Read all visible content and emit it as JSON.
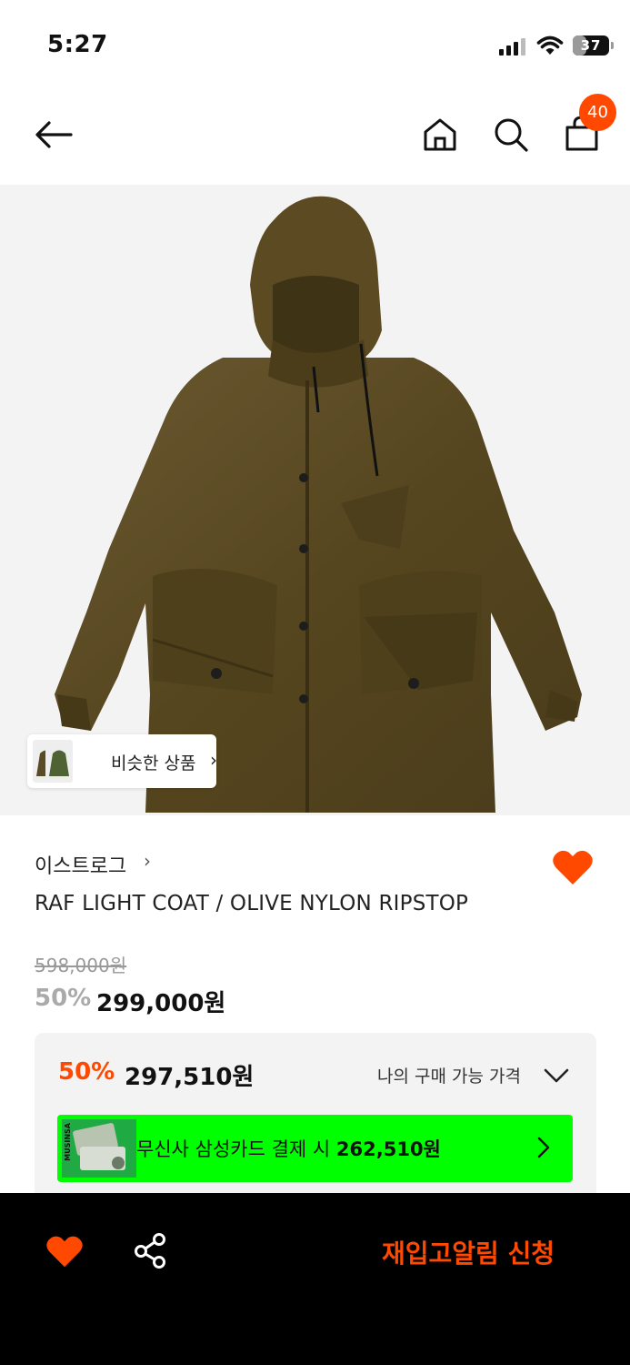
{
  "status_bar": {
    "time": "5:27",
    "battery_text": "37",
    "battery_level": 0.37,
    "icons": [
      "cellular-signal-icon",
      "wifi-icon",
      "battery-icon"
    ]
  },
  "nav": {
    "icons": [
      "back-arrow-icon",
      "home-icon",
      "search-icon",
      "shopping-bag-icon"
    ],
    "cart_count": "40"
  },
  "product_image": {
    "subject": "olive-parka-photo"
  },
  "similar": {
    "label": "비슷한 상품",
    "arrow": "›"
  },
  "product": {
    "brand": "이스트로그",
    "brand_arrow": "›",
    "name": "RAF LIGHT COAT / OLIVE NYLON RIPSTOP",
    "original_price": "598,000원",
    "discount_rate": "50%",
    "sale_price": "299,000원",
    "liked": true
  },
  "benefit": {
    "rate": "50%",
    "price": "297,510원",
    "toggle_label": "나의 구매 가능 가격"
  },
  "card_banner": {
    "thumb_text": "MUSINSA",
    "text": "무신사 삼성카드 결제 시 ",
    "amount": "262,510원"
  },
  "bottom_bar": {
    "restock_label": "재입고알림 신청"
  },
  "colors": {
    "accent": "#ff4800",
    "card_green": "#00ff00",
    "olive": "#5a4a25"
  }
}
